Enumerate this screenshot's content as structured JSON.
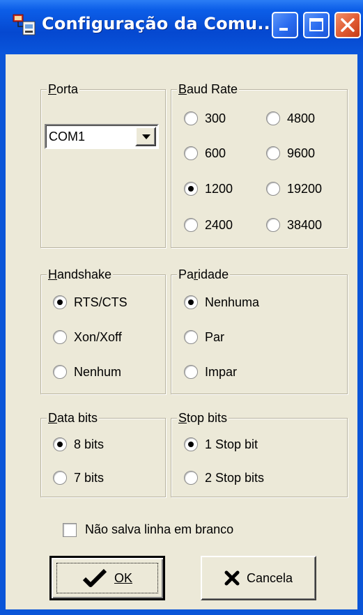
{
  "window": {
    "title": "Configuração da Comu...",
    "controls": [
      "minimize",
      "maximize",
      "close"
    ]
  },
  "porta": {
    "label": "Porta",
    "selected": "COM1"
  },
  "baud_rate": {
    "label": "Baud Rate",
    "options": [
      "300",
      "4800",
      "600",
      "9600",
      "1200",
      "19200",
      "2400",
      "38400"
    ],
    "selected": "1200"
  },
  "handshake": {
    "label": "Handshake",
    "options": [
      "RTS/CTS",
      "Xon/Xoff",
      "Nenhum"
    ],
    "selected": "RTS/CTS"
  },
  "paridade": {
    "label": "Paridade",
    "options": [
      "Nenhuma",
      "Par",
      "Impar"
    ],
    "selected": "Nenhuma"
  },
  "data_bits": {
    "label": "Data bits",
    "options": [
      "8 bits",
      "7 bits"
    ],
    "selected": "8 bits"
  },
  "stop_bits": {
    "label": "Stop bits",
    "options": [
      "1 Stop bit",
      "2 Stop bits"
    ],
    "selected": "1 Stop bit"
  },
  "checkbox": {
    "label": "Não salva linha em branco",
    "checked": false
  },
  "buttons": {
    "ok": "OK",
    "cancel": "Cancela"
  },
  "icons": {
    "title": "network-config-icon",
    "ok": "checkmark-icon",
    "cancel": "x-icon"
  }
}
